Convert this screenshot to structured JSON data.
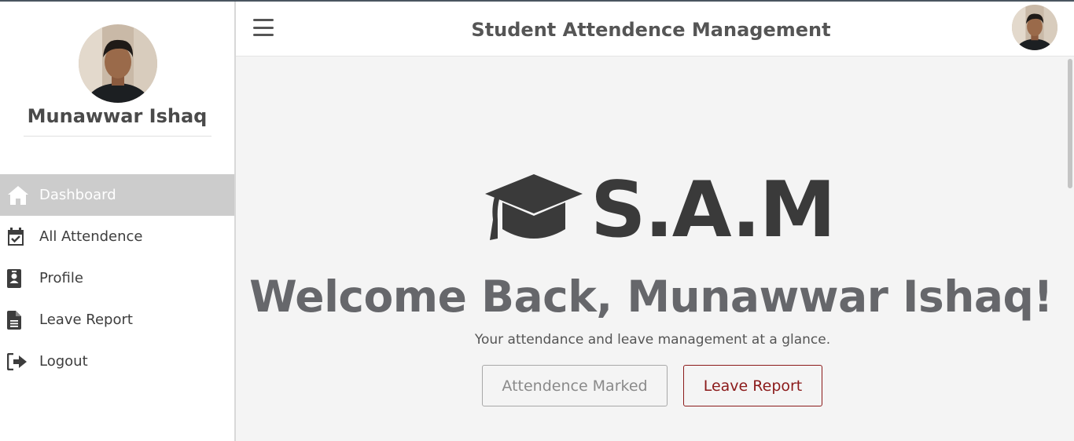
{
  "app": {
    "title": "Student Attendence Management"
  },
  "user": {
    "name": "Munawwar Ishaq"
  },
  "sidebar": {
    "items": [
      {
        "label": "Dashboard",
        "icon": "home-icon",
        "active": true
      },
      {
        "label": "All Attendence",
        "icon": "calendar-check-icon",
        "active": false
      },
      {
        "label": "Profile",
        "icon": "id-badge-icon",
        "active": false
      },
      {
        "label": "Leave Report",
        "icon": "file-lines-icon",
        "active": false
      },
      {
        "label": "Logout",
        "icon": "sign-out-icon",
        "active": false
      }
    ]
  },
  "main": {
    "logo_text": "S.A.M",
    "logo_icon": "graduation-cap-icon",
    "welcome": "Welcome Back, Munawwar Ishaq!",
    "subtitle": "Your attendance and leave management at a glance.",
    "buttons": {
      "attendance_marked": "Attendence Marked",
      "leave_report": "Leave Report"
    }
  },
  "colors": {
    "active_nav_bg": "#cccccc",
    "main_bg": "#f4f4f4",
    "leave_button": "#8b1a1a",
    "title_text": "#555555"
  }
}
